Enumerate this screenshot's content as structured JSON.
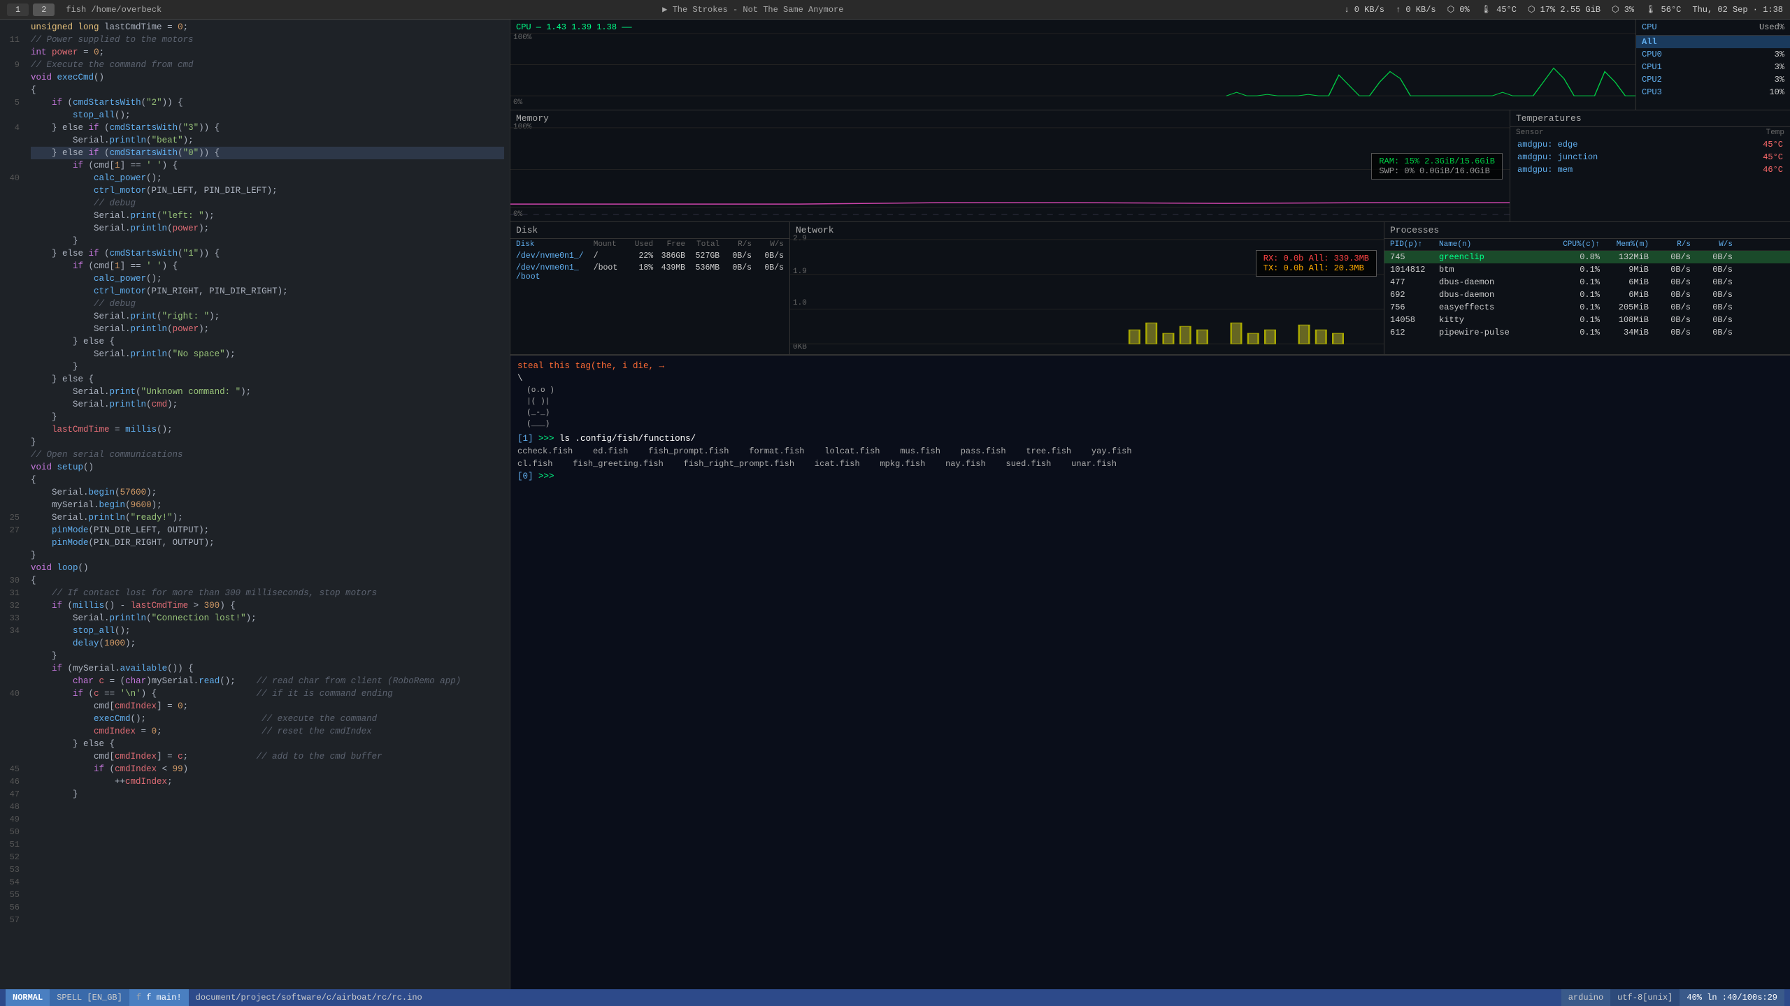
{
  "topbar": {
    "tab1": "1",
    "tab2": "2",
    "title": "fish /home/overbeck",
    "music": "▶  The Strokes - Not The Same Anymore",
    "net_down": "↓ 0 KB/s",
    "net_up": "↑ 0 KB/s",
    "disk": "⬡ 0%",
    "temp": "🌡 45°C",
    "mem": "⬡ 17% 2.55 GiB",
    "bat": "⬡ 3%",
    "temp2": "🌡 56°C",
    "datetime": "Thu, 02 Sep · 1:38"
  },
  "cpu_panel": {
    "title": "CPU — 1.43  1.39  1.38",
    "y100": "100%",
    "y0": "0%",
    "rows": [
      {
        "label": "All",
        "pct": "",
        "selected": true
      },
      {
        "label": "CPU0",
        "pct": "3%",
        "selected": false
      },
      {
        "label": "CPU1",
        "pct": "3%",
        "selected": false
      },
      {
        "label": "CPU2",
        "pct": "3%",
        "selected": false
      },
      {
        "label": "CPU3",
        "pct": "10%",
        "selected": false
      }
    ],
    "header_cpu": "CPU",
    "header_used": "Used%"
  },
  "memory_panel": {
    "title": "Memory",
    "y100": "100%",
    "y0": "0%",
    "ram_label": "RAM: 15%",
    "ram_val": "2.3GiB/15.6GiB",
    "swap_label": "SWP:  0%",
    "swap_val": "0.0GiB/16.0GiB"
  },
  "temp_panel": {
    "title": "Temperatures",
    "header_sensor": "Sensor",
    "header_temp": "Temp",
    "rows": [
      {
        "sensor": "amdgpu: edge",
        "temp": "45°C"
      },
      {
        "sensor": "amdgpu: junction",
        "temp": "45°C"
      },
      {
        "sensor": "amdgpu: mem",
        "temp": "46°C"
      }
    ]
  },
  "disk_panel": {
    "title": "Disk",
    "headers": [
      "Disk",
      "Mount",
      "Used",
      "Free",
      "Total",
      "R/s",
      "W/s"
    ],
    "rows": [
      {
        "disk": "/dev/nvme0n1_/",
        "mount": "/",
        "used": "22%",
        "free": "386GB",
        "total": "527GB",
        "rs": "0B/s",
        "ws": "0B/s"
      },
      {
        "disk": "/dev/nvme0n1_ /boot",
        "mount": "/boot",
        "used": "18%",
        "free": "439MB",
        "total": "536MB",
        "rs": "0B/s",
        "ws": "0B/s"
      }
    ]
  },
  "network_panel": {
    "title": "Network",
    "y_vals": [
      "2.9",
      "1.9",
      "1.0",
      "0KB"
    ],
    "rx_label": "RX: 0.0b",
    "rx_all": "All: 339.3MB",
    "tx_label": "TX: 0.0b",
    "tx_all": "All: 20.3MB"
  },
  "processes_panel": {
    "title": "Processes",
    "headers": [
      "PID(p)↑",
      "Name(n)",
      "CPU%(c)↑",
      "Mem%(m)",
      "R/s",
      "W/s"
    ],
    "rows": [
      {
        "pid": "745",
        "name": "greenclip",
        "cpu": "0.8%",
        "mem": "132MiB",
        "rs": "0B/s",
        "ws": "0B/s",
        "selected": true
      },
      {
        "pid": "1014812",
        "name": "btm",
        "cpu": "0.1%",
        "mem": "9MiB",
        "rs": "0B/s",
        "ws": "0B/s",
        "selected": false
      },
      {
        "pid": "477",
        "name": "dbus-daemon",
        "cpu": "0.1%",
        "mem": "6MiB",
        "rs": "0B/s",
        "ws": "0B/s",
        "selected": false
      },
      {
        "pid": "692",
        "name": "dbus-daemon",
        "cpu": "0.1%",
        "mem": "6MiB",
        "rs": "0B/s",
        "ws": "0B/s",
        "selected": false
      },
      {
        "pid": "756",
        "name": "easyeffects",
        "cpu": "0.1%",
        "mem": "205MiB",
        "rs": "0B/s",
        "ws": "0B/s",
        "selected": false
      },
      {
        "pid": "14058",
        "name": "kitty",
        "cpu": "0.1%",
        "mem": "108MiB",
        "rs": "0B/s",
        "ws": "0B/s",
        "selected": false
      },
      {
        "pid": "612",
        "name": "pipewire-pulse",
        "cpu": "0.1%",
        "mem": "34MiB",
        "rs": "0B/s",
        "ws": "0B/s",
        "selected": false
      }
    ]
  },
  "terminal": {
    "prompt1": "steal this tag(the, i die, →",
    "ascii_art": [
      "\\",
      "",
      "  (o.o )",
      "  |( )|",
      "  (_-_)",
      "  (___)"
    ],
    "cmd_dir": "[1] >>> ls .config/fish/functions/",
    "files_line1": "ccheck.fish   ed.fish   fish_prompt.fish   format.fish   lolcat.fish   mus.fish   pass.fish   tree.fish   yay.fish",
    "files_line2": "cl.fish   fish_greeting.fish   fish_right_prompt.fish   icat.fish   mpkg.fish   nay.fish   sued.fish   unar.fish",
    "prompt2": "[0] >>>"
  },
  "code": {
    "lines": [
      {
        "num": "",
        "text": "unsigned long lastCmdTime = 0;"
      },
      {
        "num": "11",
        "text": ""
      },
      {
        "num": "",
        "text": "// Power supplied to the motors"
      },
      {
        "num": "9",
        "text": "int power = 0;"
      },
      {
        "num": "",
        "text": ""
      },
      {
        "num": "",
        "text": "// Execute the command from cmd"
      },
      {
        "num": "5",
        "text": "void execCmd()"
      },
      {
        "num": "",
        "text": "{"
      },
      {
        "num": "4",
        "text": "    if (cmdStartsWith(\"2\")) {"
      },
      {
        "num": "",
        "text": "        stop_all();"
      },
      {
        "num": "",
        "text": "    } else if (cmdStartsWith(\"3\")) {"
      },
      {
        "num": "",
        "text": "        Serial.println(\"beat\");"
      },
      {
        "num": "40",
        "text": "    } else if (cmdStartsWith(\"0\")) {"
      },
      {
        "num": "",
        "text": "        if (cmd[1] == ' ') {"
      },
      {
        "num": "",
        "text": "            calc_power();"
      },
      {
        "num": "",
        "text": "            ctrl_motor(PIN_LEFT, PIN_DIR_LEFT);"
      },
      {
        "num": "",
        "text": "            // debug"
      },
      {
        "num": "",
        "text": "            Serial.print(\"left: \");"
      },
      {
        "num": "",
        "text": "            Serial.println(power);"
      },
      {
        "num": "",
        "text": "        }"
      },
      {
        "num": "",
        "text": "    } else if (cmdStartsWith(\"1\")) {"
      },
      {
        "num": "",
        "text": "        if (cmd[1] == ' ') {"
      },
      {
        "num": "",
        "text": "            calc_power();"
      },
      {
        "num": "",
        "text": "            ctrl_motor(PIN_RIGHT, PIN_DIR_RIGHT);"
      },
      {
        "num": "",
        "text": "            // debug"
      },
      {
        "num": "",
        "text": "            Serial.print(\"right: \");"
      },
      {
        "num": "",
        "text": "            Serial.println(power);"
      },
      {
        "num": "",
        "text": "        } else {"
      },
      {
        "num": "",
        "text": "            Serial.println(\"No space\");"
      },
      {
        "num": "",
        "text": "        }"
      },
      {
        "num": "",
        "text": "    } else {"
      },
      {
        "num": "",
        "text": "        Serial.print(\"Unknown command: \");"
      },
      {
        "num": "",
        "text": "        Serial.println(cmd);"
      },
      {
        "num": "",
        "text": "    }"
      },
      {
        "num": "",
        "text": ""
      },
      {
        "num": "",
        "text": "    lastCmdTime = millis();"
      },
      {
        "num": "",
        "text": ""
      },
      {
        "num": "",
        "text": "}"
      },
      {
        "num": "",
        "text": ""
      },
      {
        "num": "25",
        "text": ""
      },
      {
        "num": "27",
        "text": "// Open serial communications"
      },
      {
        "num": "",
        "text": "void setup()"
      },
      {
        "num": "",
        "text": "{"
      },
      {
        "num": "",
        "text": "    Serial.begin(57600);"
      },
      {
        "num": "30",
        "text": "    mySerial.begin(9600);"
      },
      {
        "num": "31",
        "text": "    Serial.println(\"ready!\");"
      },
      {
        "num": "32",
        "text": "    pinMode(PIN_DIR_LEFT, OUTPUT);"
      },
      {
        "num": "33",
        "text": "    pinMode(PIN_DIR_RIGHT, OUTPUT);"
      },
      {
        "num": "34",
        "text": "}"
      },
      {
        "num": "",
        "text": ""
      },
      {
        "num": "",
        "text": "void loop()"
      },
      {
        "num": "",
        "text": "{"
      },
      {
        "num": "",
        "text": "    // If contact lost for more than 300 milliseconds, stop motors"
      },
      {
        "num": "40",
        "text": "    if (millis() - lastCmdTime > 300) {"
      },
      {
        "num": "",
        "text": "        Serial.println(\"Connection lost!\");"
      },
      {
        "num": "",
        "text": "        stop_all();"
      },
      {
        "num": "",
        "text": "        delay(1000);"
      },
      {
        "num": "",
        "text": "    }"
      },
      {
        "num": "",
        "text": ""
      },
      {
        "num": "45",
        "text": "    if (mySerial.available()) {"
      },
      {
        "num": "46",
        "text": "        char c = (char)mySerial.read();    // read char from client (RoboRemo app)"
      },
      {
        "num": "47",
        "text": ""
      },
      {
        "num": "48",
        "text": "        if (c == '\\n') {                   // if it is command ending"
      },
      {
        "num": "49",
        "text": "            cmd[cmdIndex] = 0;"
      },
      {
        "num": "50",
        "text": "            execCmd();                      // execute the command"
      },
      {
        "num": "51",
        "text": "            cmdIndex = 0;                   // reset the cmdIndex"
      },
      {
        "num": "52",
        "text": "        } else {"
      },
      {
        "num": "53",
        "text": "            cmd[cmdIndex] = c;             // add to the cmd buffer"
      },
      {
        "num": "54",
        "text": ""
      },
      {
        "num": "55",
        "text": "            if (cmdIndex < 99)"
      },
      {
        "num": "56",
        "text": "                ++cmdIndex;"
      },
      {
        "num": "57",
        "text": "        }"
      }
    ]
  },
  "statusbar": {
    "mode": "NORMAL",
    "spell": "SPELL [EN_GB]",
    "branch": "f main!",
    "file": "document/project/software/c/airboat/rc/rc.ino",
    "filetype": "arduino",
    "encoding": "utf-8[unix]",
    "position": "40% ln :40/100s:29"
  }
}
